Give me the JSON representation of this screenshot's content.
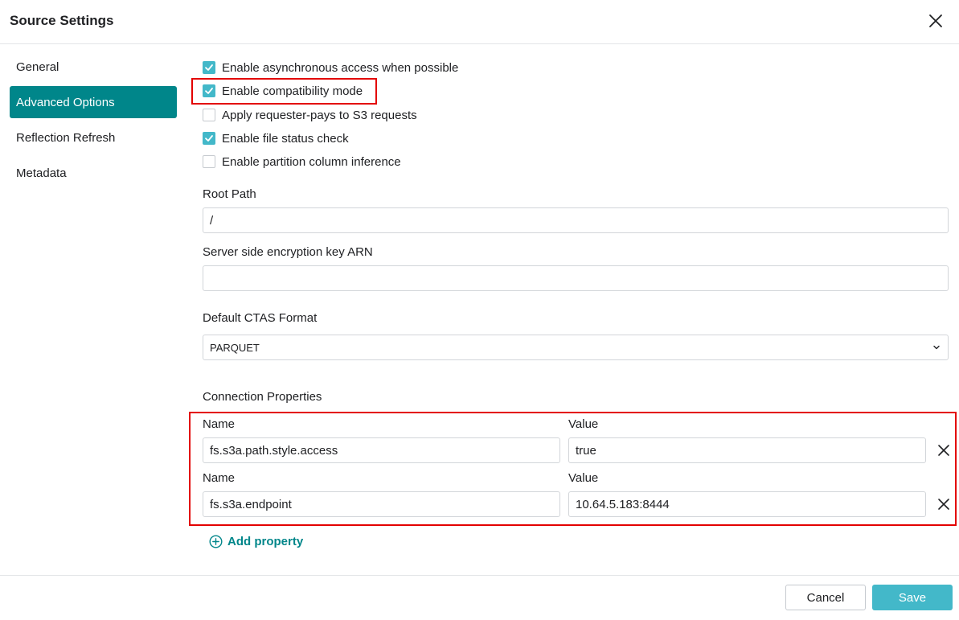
{
  "header": {
    "title": "Source Settings",
    "close_icon": "close-icon"
  },
  "sidebar": {
    "items": [
      {
        "label": "General",
        "active": false
      },
      {
        "label": "Advanced Options",
        "active": true
      },
      {
        "label": "Reflection Refresh",
        "active": false
      },
      {
        "label": "Metadata",
        "active": false
      }
    ]
  },
  "options": [
    {
      "label": "Enable asynchronous access when possible",
      "checked": true
    },
    {
      "label": "Enable compatibility mode",
      "checked": true
    },
    {
      "label": "Apply requester-pays to S3 requests",
      "checked": false
    },
    {
      "label": "Enable file status check",
      "checked": true
    },
    {
      "label": "Enable partition column inference",
      "checked": false
    }
  ],
  "root_path": {
    "label": "Root Path",
    "value": "/"
  },
  "encryption_key": {
    "label": "Server side encryption key ARN",
    "value": ""
  },
  "ctas_format": {
    "label": "Default CTAS Format",
    "value": "PARQUET"
  },
  "connection_properties": {
    "label": "Connection Properties",
    "name_label": "Name",
    "value_label": "Value",
    "rows": [
      {
        "name": "fs.s3a.path.style.access",
        "value": "true"
      },
      {
        "name": "fs.s3a.endpoint",
        "value": "10.64.5.183:8444"
      }
    ],
    "add_label": "Add property"
  },
  "footer": {
    "cancel_label": "Cancel",
    "save_label": "Save"
  },
  "colors": {
    "accent": "#00868a",
    "checkbox": "#43b8c9",
    "highlight": "#e30000"
  }
}
